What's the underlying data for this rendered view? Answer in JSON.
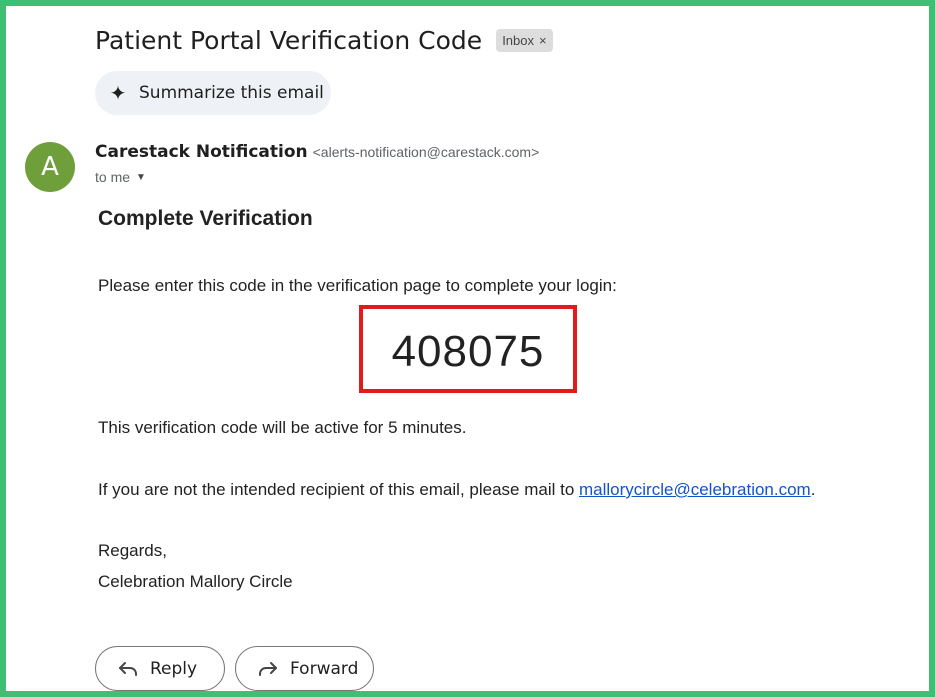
{
  "email": {
    "subject": "Patient Portal Verification Code",
    "label_chip": "Inbox",
    "label_chip_close": "×",
    "summarize_label": "Summarize this email",
    "sender": {
      "avatar_letter": "A",
      "avatar_color": "#6f9f3a",
      "name": "Carestack Notification",
      "email": "<alerts-notification@carestack.com>",
      "recipient": "to me"
    },
    "body": {
      "heading": "Complete Verification",
      "instruction": "Please enter this code in the verification page to complete your login:",
      "code": "408075",
      "validity": "This verification code will be active for 5 minutes.",
      "notice_prefix": "If you are not the intended recipient of this email, please mail to ",
      "notice_link": "mallorycircle@celebration.com",
      "notice_suffix": ".",
      "regards": "Regards,",
      "signature": "Celebration Mallory Circle"
    },
    "actions": {
      "reply_label": "Reply",
      "forward_label": "Forward"
    }
  },
  "colors": {
    "frame_border": "#3fbf73",
    "highlight_box": "#e01b1b",
    "link": "#1155cc"
  }
}
